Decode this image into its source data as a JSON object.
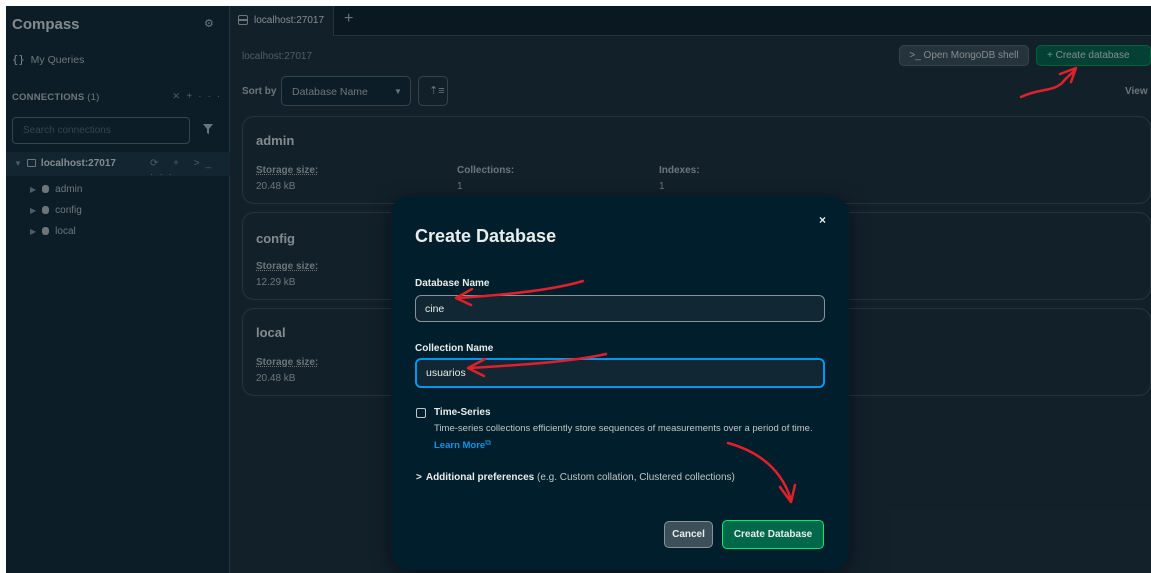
{
  "sidebar": {
    "app_name": "Compass",
    "my_queries": "My Queries",
    "connections_label": "CONNECTIONS",
    "connections_count": "(1)",
    "search_placeholder": "Search connections",
    "host": "localhost:27017",
    "databases": [
      "admin",
      "config",
      "local"
    ]
  },
  "tabs": [
    {
      "label": "localhost:27017"
    }
  ],
  "main": {
    "breadcrumb": "localhost:27017",
    "open_shell_label": ">_ Open MongoDB shell",
    "create_database_label": "+ Create database",
    "sort_by_label": "Sort by",
    "sort_value": "Database Name",
    "view_label": "View"
  },
  "databases": [
    {
      "name": "admin",
      "storage_label": "Storage size:",
      "storage": "20.48 kB",
      "collections_label": "Collections:",
      "collections": "1",
      "indexes_label": "Indexes:",
      "indexes": "1"
    },
    {
      "name": "config",
      "storage_label": "Storage size:",
      "storage": "12.29 kB"
    },
    {
      "name": "local",
      "storage_label": "Storage size:",
      "storage": "20.48 kB"
    }
  ],
  "modal": {
    "title": "Create Database",
    "close": "×",
    "db_name_label": "Database Name",
    "db_name_value": "cine",
    "coll_name_label": "Collection Name",
    "coll_name_value": "usuarios",
    "timeseries_label": "Time-Series",
    "timeseries_desc": "Time-series collections efficiently store sequences of measurements over a period of time.",
    "learn_more": "Learn More",
    "adv_label": "Additional preferences",
    "adv_hint": "(e.g. Custom collation, Clustered collections)",
    "cancel_label": "Cancel",
    "submit_label": "Create Database"
  },
  "colors": {
    "accent_green": "#00684a",
    "focus_blue": "#0498ec",
    "annotation_red": "#e0202a"
  }
}
